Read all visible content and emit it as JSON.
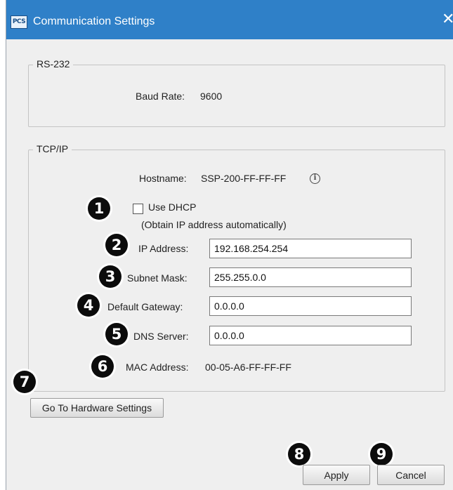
{
  "window": {
    "title": "Communication Settings",
    "app_icon_text": "PCS",
    "close_glyph": "✕"
  },
  "rs232": {
    "legend": "RS-232",
    "baud_label": "Baud Rate:",
    "baud_value": "9600"
  },
  "tcpip": {
    "legend": "TCP/IP",
    "hostname_label": "Hostname:",
    "hostname_value": "SSP-200-FF-FF-FF",
    "info_glyph": "i",
    "dhcp_label": "Use DHCP",
    "dhcp_hint": "(Obtain IP address automatically)",
    "dhcp_checked": false,
    "ip_label": "IP Address:",
    "ip_value": "192.168.254.254",
    "subnet_label": "Subnet Mask:",
    "subnet_value": "255.255.0.0",
    "gateway_label": "Default Gateway:",
    "gateway_value": "0.0.0.0",
    "dns_label": "DNS Server:",
    "dns_value": "0.0.0.0",
    "mac_label": "MAC Address:",
    "mac_value": "00-05-A6-FF-FF-FF"
  },
  "buttons": {
    "hardware": "Go To Hardware Settings",
    "apply": "Apply",
    "cancel": "Cancel"
  },
  "callouts": [
    "1",
    "2",
    "3",
    "4",
    "5",
    "6",
    "7",
    "8",
    "9"
  ],
  "colors": {
    "titlebar": "#2f80c8",
    "callout": "#0c0c0c"
  }
}
